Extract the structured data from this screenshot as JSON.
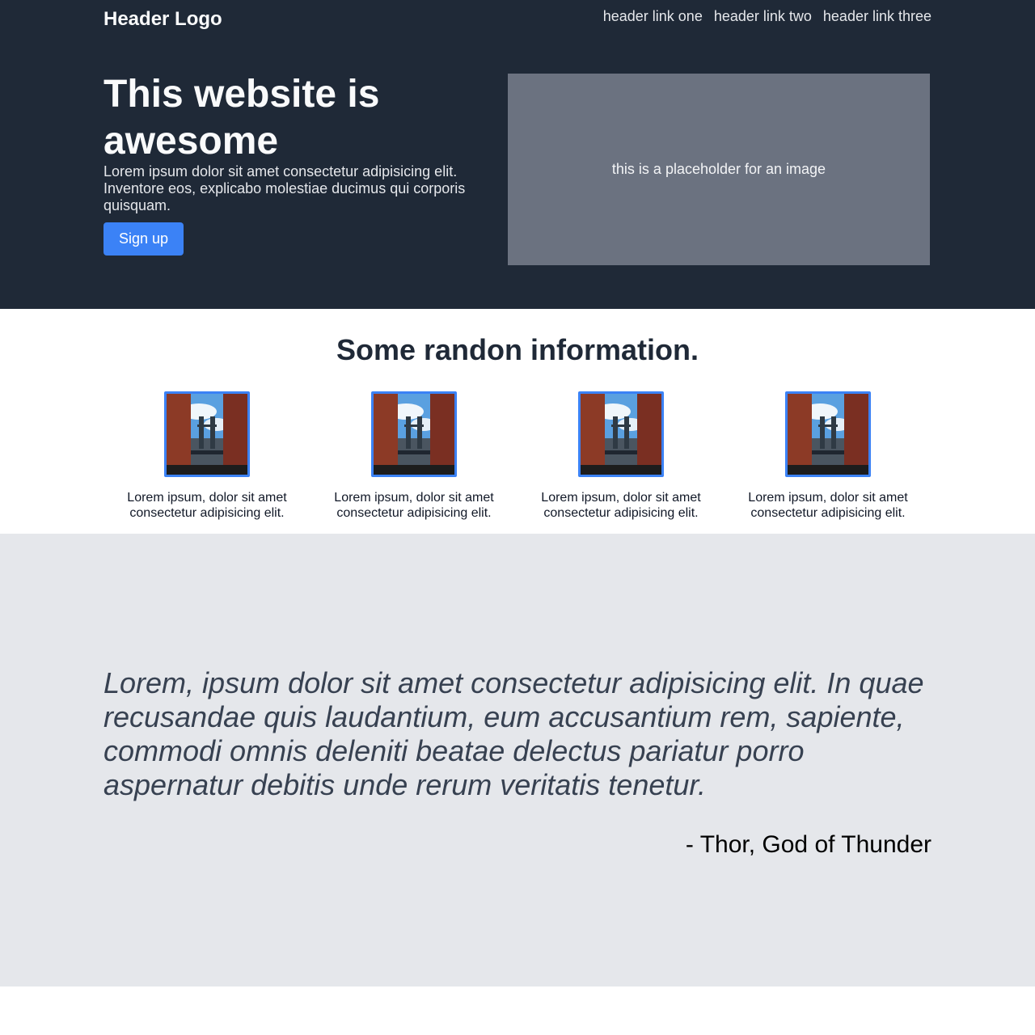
{
  "header": {
    "logo": "Header Logo",
    "links": [
      "header link one",
      "header link two",
      "header link three"
    ]
  },
  "hero": {
    "title": "This website is awesome",
    "text": "Lorem ipsum dolor sit amet consectetur adipisicing elit. Inventore eos, explicabo molestiae ducimus qui corporis quisquam.",
    "button_label": "Sign up",
    "image_placeholder": "this is a placeholder for an image"
  },
  "info": {
    "title": "Some randon information.",
    "cards": [
      {
        "text": "Lorem ipsum, dolor sit amet consectetur adipisicing elit."
      },
      {
        "text": "Lorem ipsum, dolor sit amet consectetur adipisicing elit."
      },
      {
        "text": "Lorem ipsum, dolor sit amet consectetur adipisicing elit."
      },
      {
        "text": "Lorem ipsum, dolor sit amet consectetur adipisicing elit."
      }
    ]
  },
  "quote": {
    "text": "Lorem, ipsum dolor sit amet consectetur adipisicing elit. In quae recusandae quis laudantium, eum accusantium rem, sapiente, commodi omnis deleniti beatae delectus pariatur porro aspernatur debitis unde rerum veritatis tenetur.",
    "author": "- Thor, God of Thunder"
  },
  "colors": {
    "hero_bg": "#1f2937",
    "accent": "#3b82f6",
    "placeholder_bg": "#6b7280",
    "quote_bg": "#e5e7eb"
  }
}
